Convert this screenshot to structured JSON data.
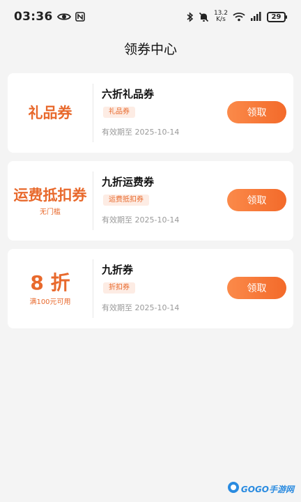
{
  "status_bar": {
    "time": "03:36",
    "speed_value": "13.2",
    "speed_unit": "K/s",
    "battery": "29"
  },
  "header": {
    "title": "领券中心"
  },
  "coupons": [
    {
      "left_main": "礼品券",
      "left_sub": "",
      "name": "六折礼品券",
      "tag": "礼品券",
      "expire": "有效期至 2025-10-14",
      "button": "领取"
    },
    {
      "left_main": "运费抵扣券",
      "left_sub": "无门槛",
      "name": "九折运费券",
      "tag": "运费抵扣券",
      "expire": "有效期至 2025-10-14",
      "button": "领取"
    },
    {
      "left_main": "8 折",
      "left_sub": "满100元可用",
      "name": "九折券",
      "tag": "折扣券",
      "expire": "有效期至 2025-10-14",
      "button": "领取"
    }
  ],
  "watermark": {
    "text": "GOGO手游网"
  },
  "colors": {
    "accent": "#e8692c",
    "button_start": "#fb8a4a",
    "button_end": "#f36a2a"
  }
}
